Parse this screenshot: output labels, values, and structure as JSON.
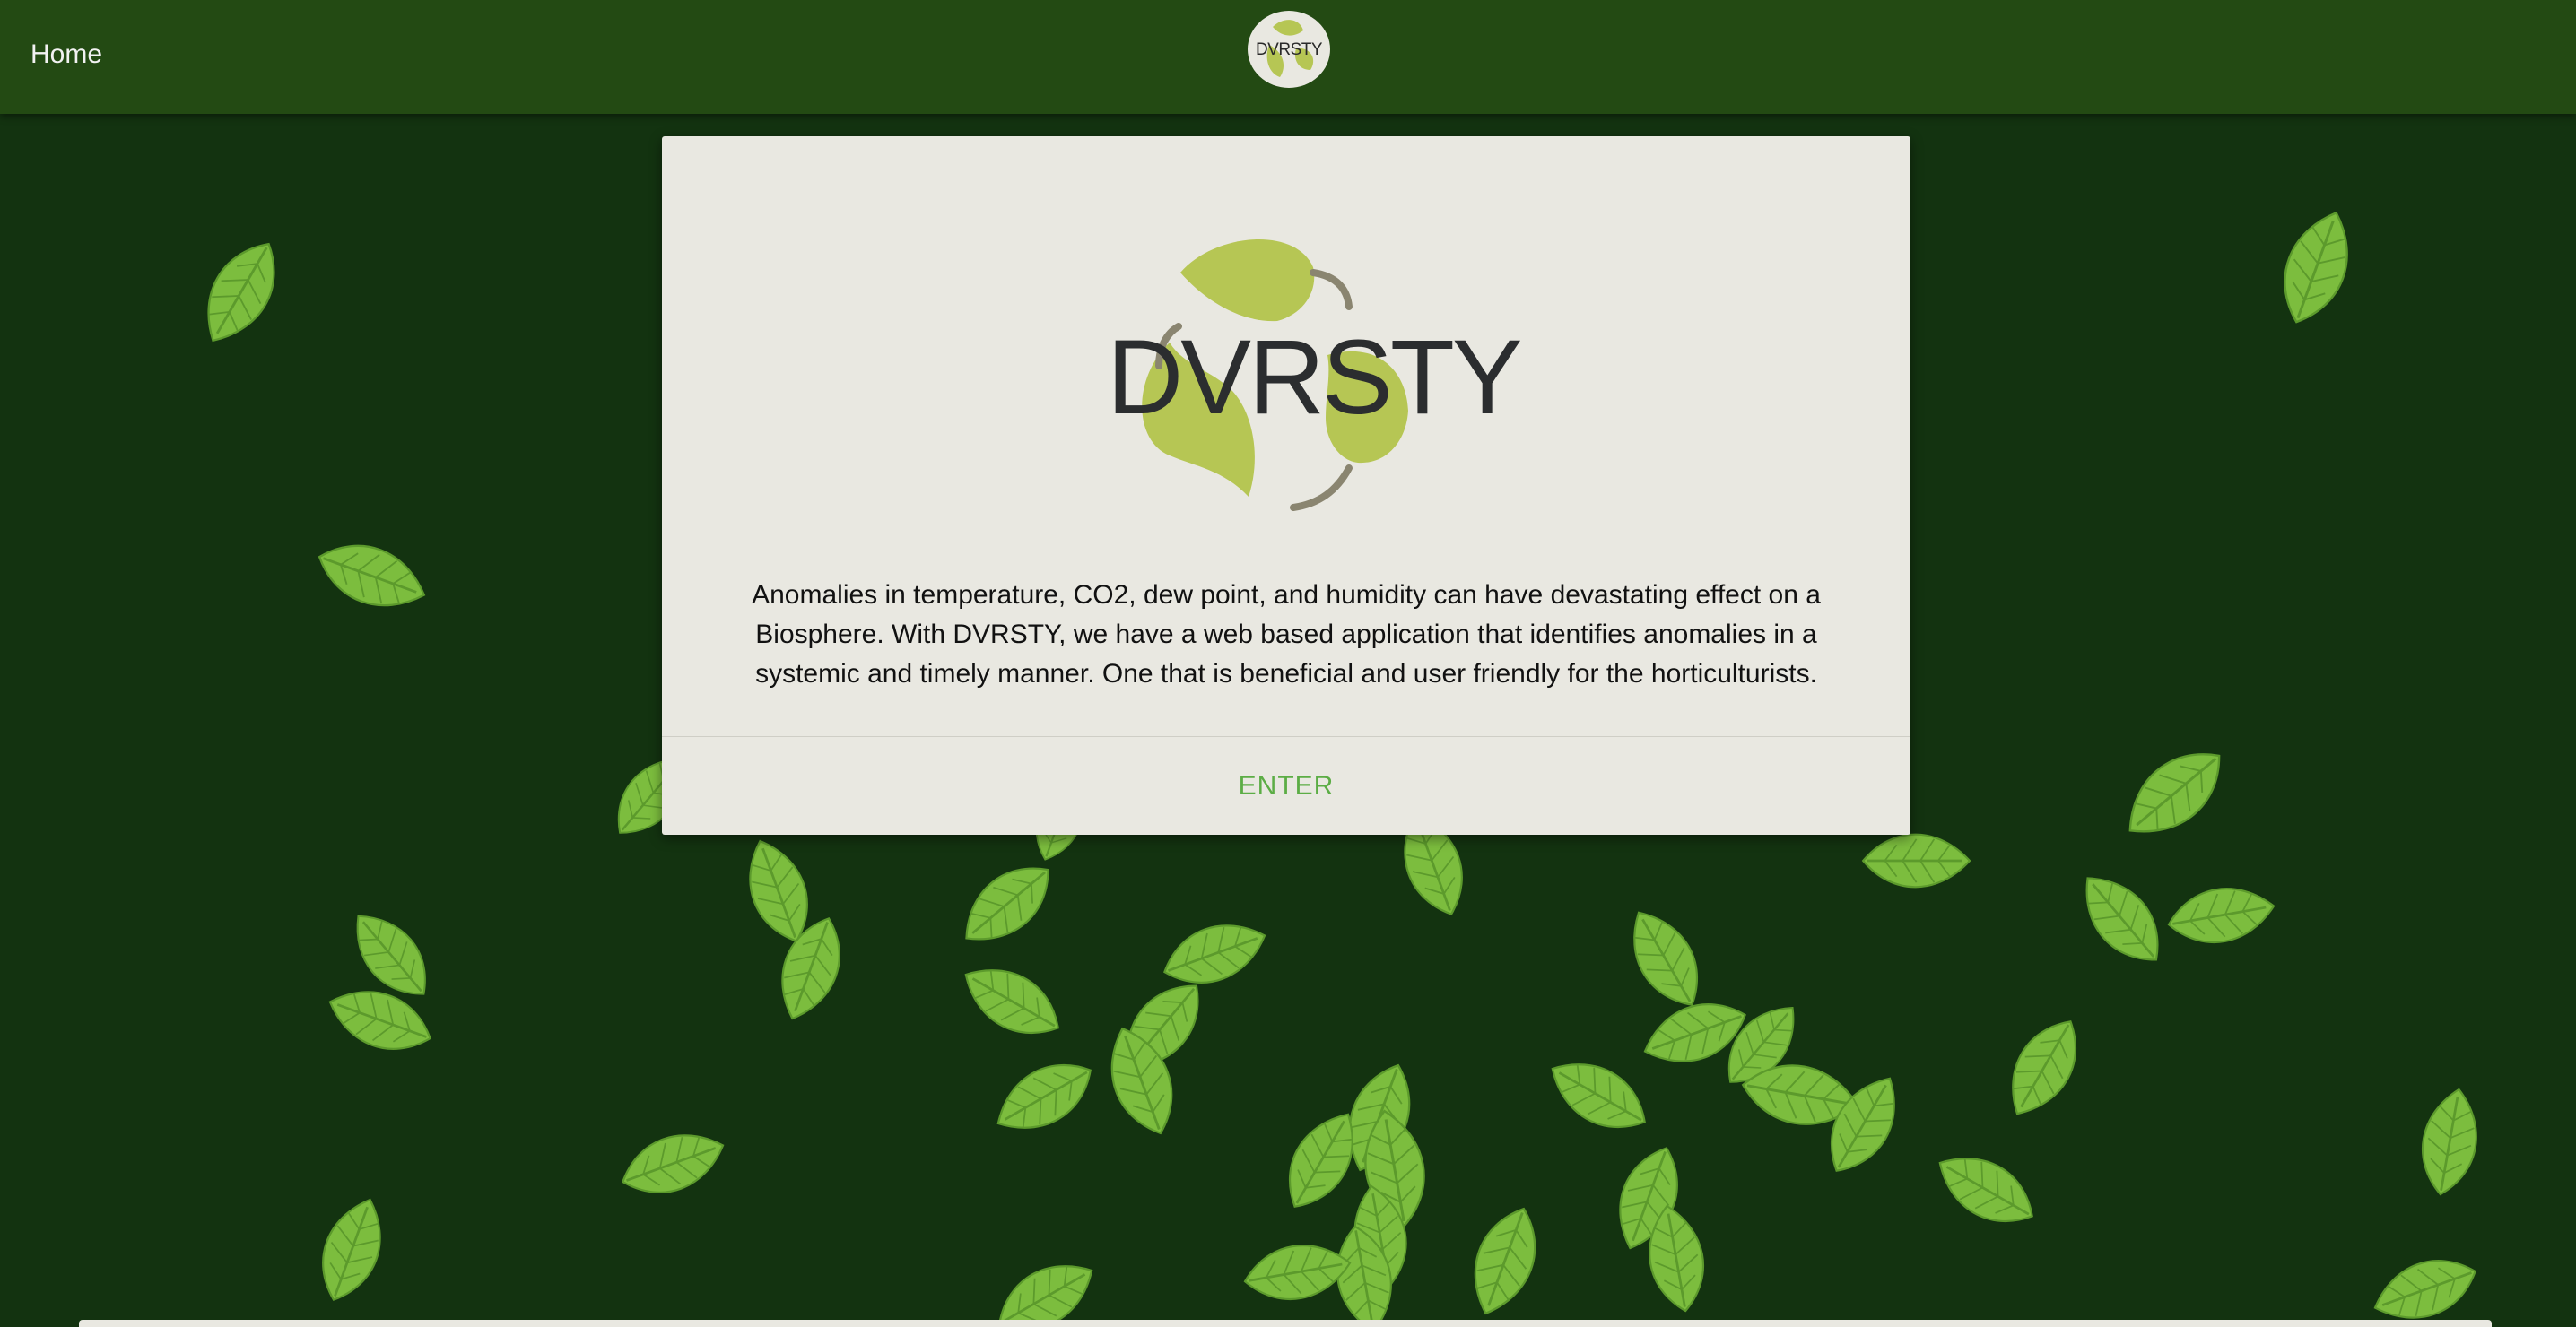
{
  "nav": {
    "home_label": "Home",
    "logo_text": "DVRSTY"
  },
  "card": {
    "logo_text": "DVRSTY",
    "description": "Anomalies in temperature, CO2, dew point, and humidity can have devastating effect on a Biosphere. With DVRSTY, we have a web based application that identifies anomalies in a systemic and timely manner. One that is beneficial and user friendly for the horticulturists.",
    "enter_label": "ENTER"
  },
  "colors": {
    "background": "#133310",
    "navbar": "#234a13",
    "card": "#e9e8e1",
    "leaf": "#7cbd3e",
    "logo_leaf": "#b6c654",
    "accent": "#5cad45"
  },
  "icons": {
    "leaf": "leaf-icon",
    "logo": "recycle-leaf-logo-icon"
  }
}
